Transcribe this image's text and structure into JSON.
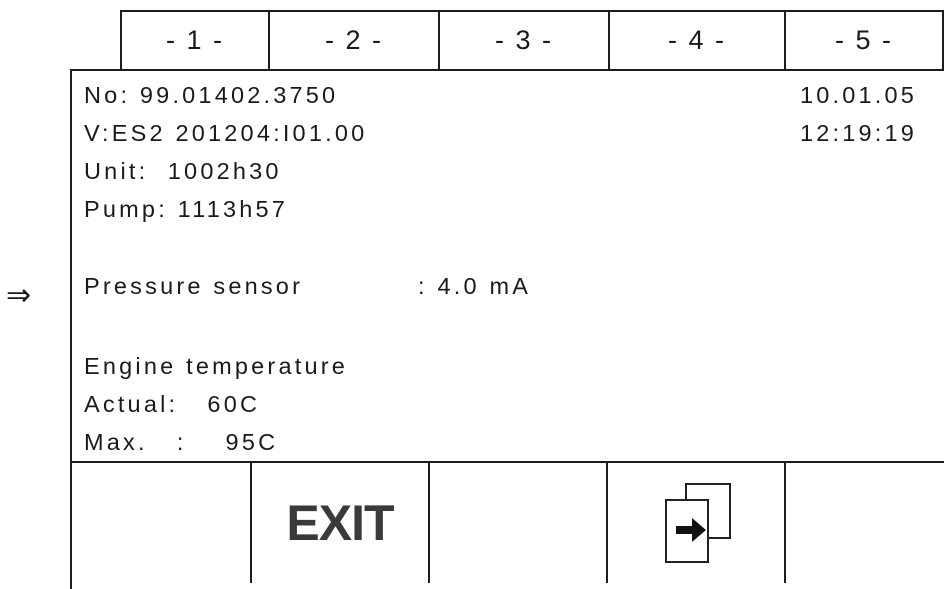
{
  "tabs": [
    "- 1 -",
    "- 2 -",
    "- 3 -",
    "- 4 -",
    "- 5 -"
  ],
  "info": {
    "serial": "No: 99.01402.3750",
    "version": "V:ES2 201204:I01.00",
    "unit_hours": "Unit:  1002h30",
    "pump_hours": "Pump: 1113h57",
    "date": "10.01.05",
    "time": "12:19:19"
  },
  "pointer": "⇒",
  "sensor": {
    "label": "Pressure sensor",
    "value": ": 4.0 mA"
  },
  "engine": {
    "title": "Engine temperature",
    "actual": "Actual:   60C",
    "max": "Max.   :    95C"
  },
  "softkeys": {
    "exit_label": "EXIT",
    "next_icon": "page-forward-icon"
  }
}
